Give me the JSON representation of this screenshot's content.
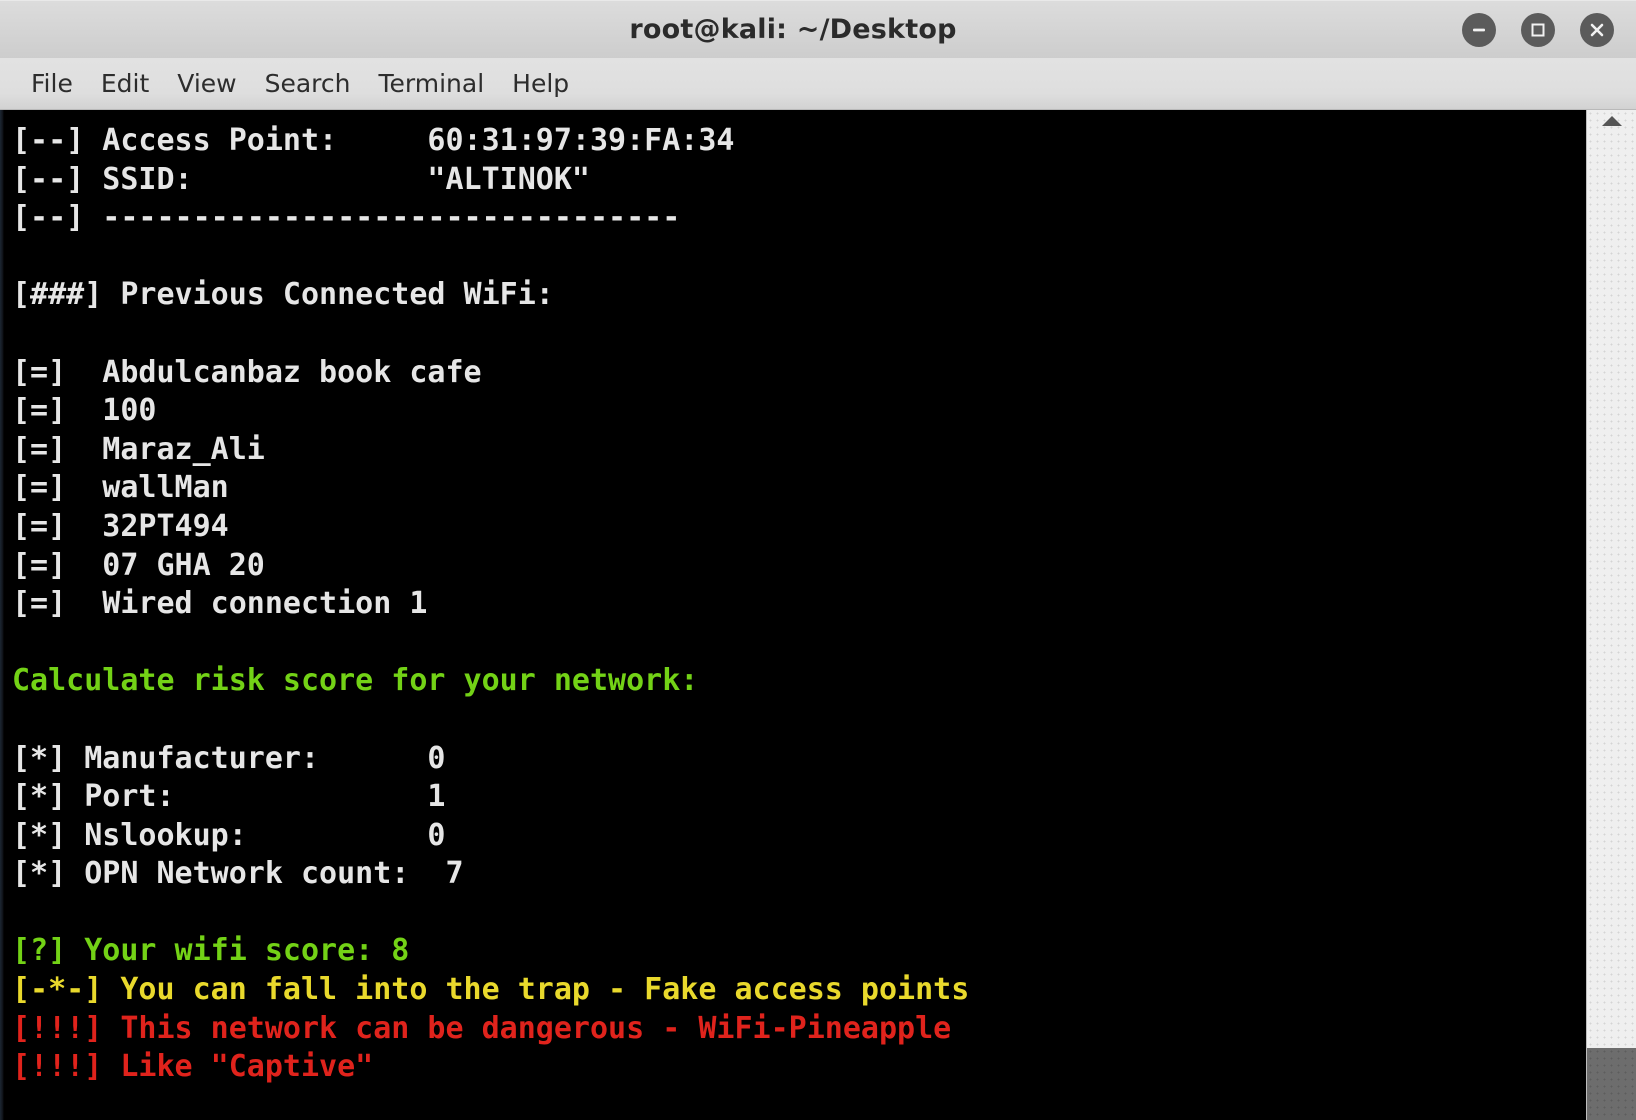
{
  "window": {
    "title": "root@kali: ~/Desktop",
    "buttons": [
      {
        "name": "minimize-button",
        "icon": "minimize-icon",
        "label": "Minimize"
      },
      {
        "name": "maximize-button",
        "icon": "maximize-icon",
        "label": "Maximize"
      },
      {
        "name": "close-button",
        "icon": "close-icon",
        "label": "Close"
      }
    ]
  },
  "menubar": {
    "items": [
      {
        "label": "File"
      },
      {
        "label": "Edit"
      },
      {
        "label": "View"
      },
      {
        "label": "Search"
      },
      {
        "label": "Terminal"
      },
      {
        "label": "Help"
      }
    ]
  },
  "colors": {
    "foreground": "#e6e6e6",
    "background": "#000000",
    "green": "#73d216",
    "bright_green": "#7ad42a",
    "yellow": "#e9d92c",
    "red": "#e0231c",
    "titlebar": "#d4d4d4",
    "menubar": "#dedede",
    "scrollbar_track": "#efefef",
    "scrollbar_thumb": "#6d6d6d"
  },
  "scrollbar": {
    "up_arrow_icon": "triangle-up-icon",
    "thumb_position": "bottom"
  },
  "terminal": {
    "access_point_tag": "[--]",
    "section_tag": "[###]",
    "item_tag": "[=]",
    "metric_tag": "[*]",
    "score_tag": "[?]",
    "warn_tag": "[-*-]",
    "danger_tag": "[!!!]",
    "lines": [
      {
        "text": "[--] Access Point:     60:31:97:39:FA:34",
        "color": "#e6e6e6"
      },
      {
        "text": "[--] SSID:             \"ALTINOK\"",
        "color": "#e6e6e6"
      },
      {
        "text": "[--] --------------------------------",
        "color": "#e6e6e6"
      },
      {
        "text": "",
        "color": "#e6e6e6"
      },
      {
        "text": "[###] Previous Connected WiFi:",
        "color": "#e6e6e6"
      },
      {
        "text": "",
        "color": "#e6e6e6"
      },
      {
        "text": "[=]  Abdulcanbaz book cafe",
        "color": "#e6e6e6"
      },
      {
        "text": "[=]  100",
        "color": "#e6e6e6"
      },
      {
        "text": "[=]  Maraz_Ali",
        "color": "#e6e6e6"
      },
      {
        "text": "[=]  wallMan",
        "color": "#e6e6e6"
      },
      {
        "text": "[=]  32PT494",
        "color": "#e6e6e6"
      },
      {
        "text": "[=]  07 GHA 20",
        "color": "#e6e6e6"
      },
      {
        "text": "[=]  Wired connection 1",
        "color": "#e6e6e6"
      },
      {
        "text": "",
        "color": "#e6e6e6"
      },
      {
        "text": "Calculate risk score for your network:",
        "color": "#73d216"
      },
      {
        "text": "",
        "color": "#e6e6e6"
      },
      {
        "text": "[*] Manufacturer:      0",
        "color": "#e6e6e6"
      },
      {
        "text": "[*] Port:              1",
        "color": "#e6e6e6"
      },
      {
        "text": "[*] Nslookup:          0",
        "color": "#e6e6e6"
      },
      {
        "text": "[*] OPN Network count:  7",
        "color": "#e6e6e6"
      },
      {
        "text": "",
        "color": "#e6e6e6"
      },
      {
        "text": "[?] Your wifi score: 8",
        "color": "#73d216"
      },
      {
        "text": "[-*-] You can fall into the trap - Fake access points",
        "color": "#e9d92c"
      },
      {
        "text": "[!!!] This network can be dangerous - WiFi-Pineapple",
        "color": "#e0231c"
      },
      {
        "text": "[!!!] Like \"Captive\"",
        "color": "#e0231c"
      }
    ],
    "details": {
      "access_point_label": "Access Point:",
      "access_point_value": "60:31:97:39:FA:34",
      "ssid_label": "SSID:",
      "ssid_value": "\"ALTINOK\"",
      "previous_wifi_header": "Previous Connected WiFi:",
      "previous_wifi": [
        "Abdulcanbaz book cafe",
        "100",
        "Maraz_Ali",
        "wallMan",
        "32PT494",
        "07 GHA 20",
        "Wired connection 1"
      ],
      "risk_header": "Calculate risk score for your network:",
      "metrics": [
        {
          "label": "Manufacturer:",
          "value": "0"
        },
        {
          "label": "Port:",
          "value": "1"
        },
        {
          "label": "Nslookup:",
          "value": "0"
        },
        {
          "label": "OPN Network count:",
          "value": "7"
        }
      ],
      "score_label": "Your wifi score:",
      "score_value": "8",
      "warning": "You can fall into the trap - Fake access points",
      "danger": "This network can be dangerous - WiFi-Pineapple"
    }
  }
}
